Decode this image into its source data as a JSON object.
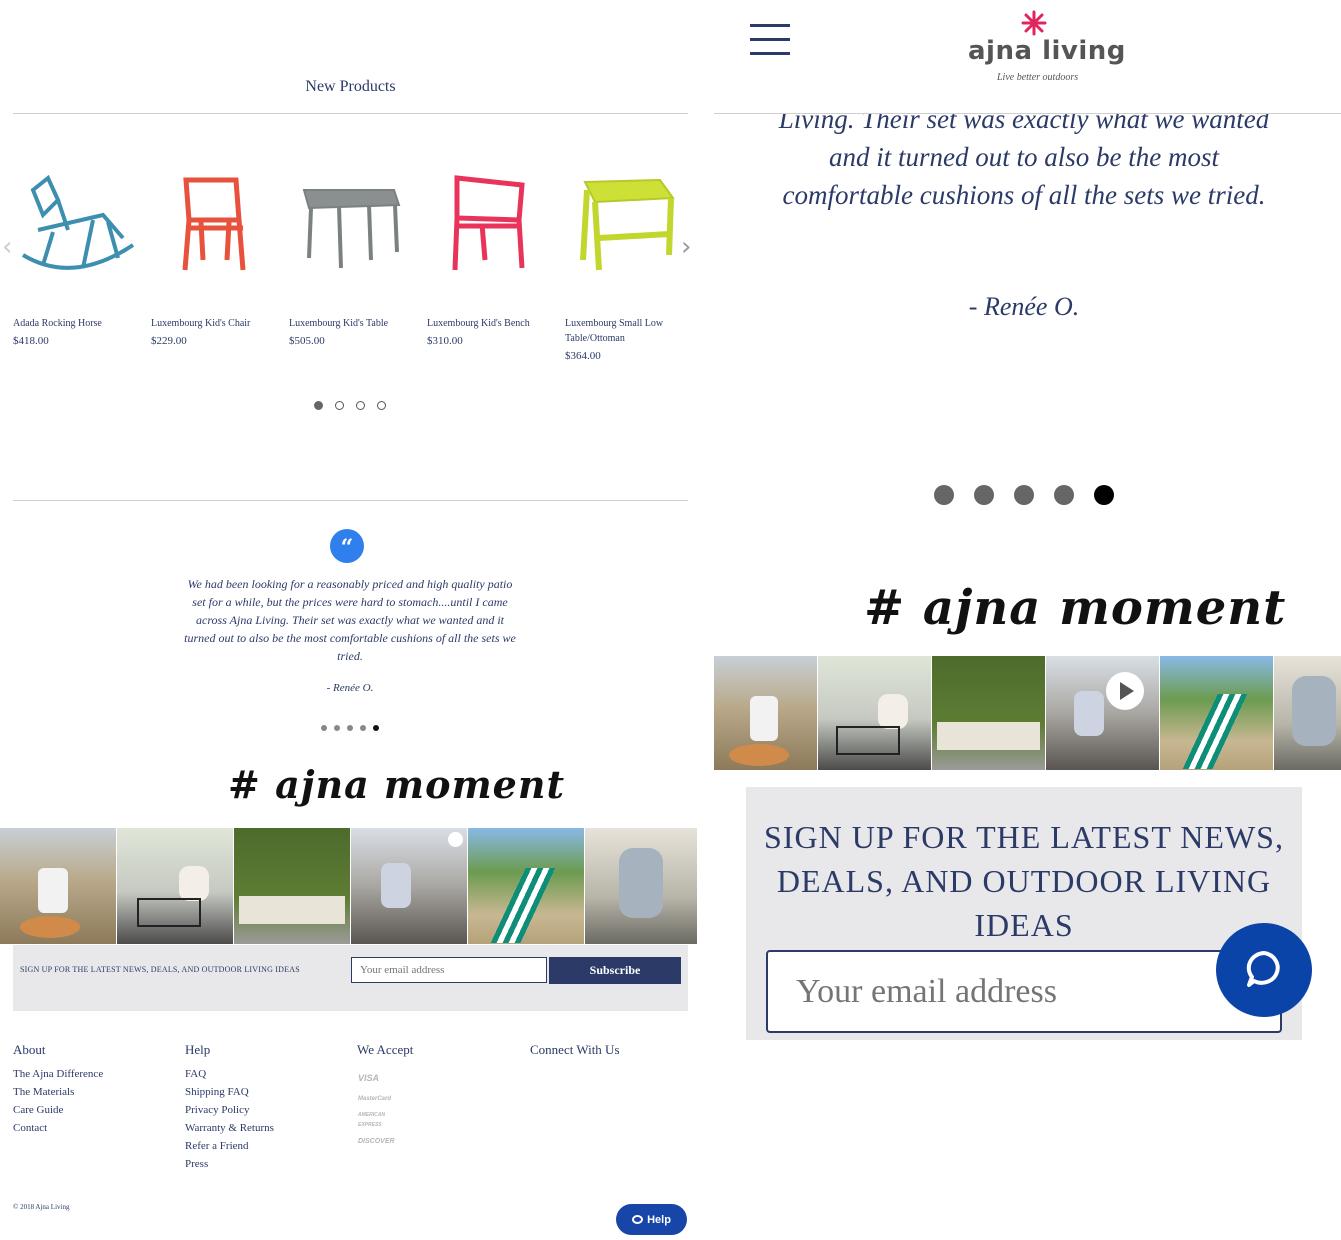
{
  "new_products": {
    "title": "New Products",
    "items": [
      {
        "name": "Adada Rocking Horse",
        "price": "$418.00"
      },
      {
        "name": "Luxembourg Kid's Chair",
        "price": "$229.00"
      },
      {
        "name": "Luxembourg Kid's Table",
        "price": "$505.00"
      },
      {
        "name": "Luxembourg Kid's Bench",
        "price": "$310.00"
      },
      {
        "name": "Luxembourg Small Low Table/Ottoman",
        "price": "$364.00"
      }
    ],
    "next_arrow": "›",
    "prev_arrow": "‹"
  },
  "testimonial": {
    "quote_mark": "“",
    "text": "We had been looking for a reasonably priced and high quality patio set for a while, but the prices were hard to stomach....until I came across Ajna Living. Their set was exactly what we wanted and it turned out to also be the most comfortable cushions of all the sets we tried.",
    "author": "- Renée O.",
    "big_text": "Living. Their set was exactly what we wanted and it turned out to also be the most comfortable cushions of all the sets we tried."
  },
  "hashtag": "# ajna moment",
  "signup": {
    "label": "SIGN UP FOR THE LATEST NEWS, DEALS, AND OUTDOOR LIVING IDEAS",
    "email_placeholder": "Your email address",
    "button": "Subscribe"
  },
  "footer": {
    "about_title": "About",
    "about_links": [
      "The Ajna Difference",
      "The Materials",
      "Care Guide",
      "Contact"
    ],
    "help_title": "Help",
    "help_links": [
      "FAQ",
      "Shipping FAQ",
      "Privacy Policy",
      "Warranty & Returns",
      "Refer a Friend",
      "Press"
    ],
    "accept_title": "We Accept",
    "cards": [
      "VISA",
      "MasterCard",
      "AMERICAN EXPRESS",
      "DISCOVER"
    ],
    "connect_title": "Connect With Us",
    "copyright": "© 2018 Ajna Living"
  },
  "help_button": {
    "label": "Help",
    "icon": "chat-bubble-icon"
  },
  "header": {
    "logo": "ajna living",
    "tagline": "Live better outdoors",
    "menu_icon": "hamburger-icon"
  },
  "colors": {
    "brand": "#2b3a67",
    "accent_blue": "#2f80ed",
    "help_blue": "#1845a8",
    "signup_bg": "#e8e8ea",
    "logo_flower": "#e0245e"
  }
}
